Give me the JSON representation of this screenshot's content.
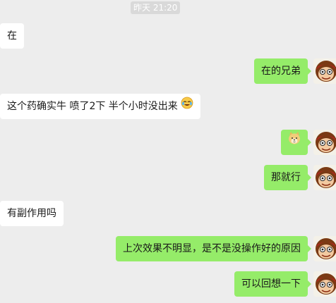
{
  "timestamp": "昨天 21:20",
  "messages": [
    {
      "side": "in",
      "text": "在"
    },
    {
      "side": "out",
      "text": "在的兄弟"
    },
    {
      "side": "in",
      "text": "这个药确实牛 喷了2下 半个小时没出来",
      "emoji": "laugh-cry-emoji"
    },
    {
      "side": "out",
      "text": "",
      "emoji": "dog-emoji"
    },
    {
      "side": "out",
      "text": "那就行"
    },
    {
      "side": "in",
      "text": "有副作用吗"
    },
    {
      "side": "out",
      "text": "上次效果不明显，是不是没操作好的原因"
    },
    {
      "side": "out",
      "text": "可以回想一下"
    }
  ],
  "colors": {
    "background": "#ededed",
    "bubble_in": "#ffffff",
    "bubble_out": "#95ec69",
    "timestamp_bg": "#d9d9d9"
  }
}
